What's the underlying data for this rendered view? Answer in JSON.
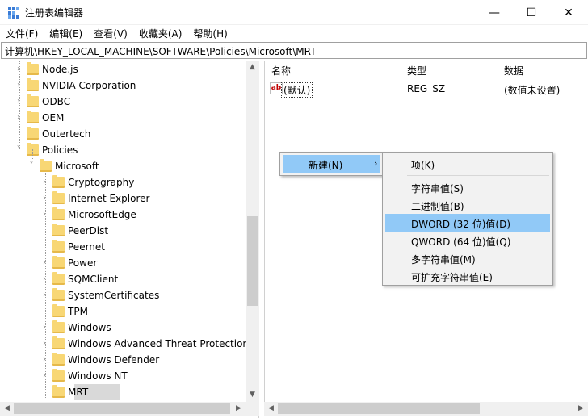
{
  "window": {
    "title": "注册表编辑器",
    "min_glyph": "—",
    "max_glyph": "☐",
    "close_glyph": "✕"
  },
  "menu": [
    "文件(F)",
    "编辑(E)",
    "查看(V)",
    "收藏夹(A)",
    "帮助(H)"
  ],
  "address": "计算机\\HKEY_LOCAL_MACHINE\\SOFTWARE\\Policies\\Microsoft\\MRT",
  "tree": [
    {
      "label": "Node.js",
      "level": 1,
      "expander": "›"
    },
    {
      "label": "NVIDIA Corporation",
      "level": 1,
      "expander": "›"
    },
    {
      "label": "ODBC",
      "level": 1,
      "expander": "›"
    },
    {
      "label": "OEM",
      "level": 1,
      "expander": "›"
    },
    {
      "label": "Outertech",
      "level": 1,
      "expander": ""
    },
    {
      "label": "Policies",
      "level": 1,
      "expander": "˅"
    },
    {
      "label": "Microsoft",
      "level": 2,
      "expander": "˅"
    },
    {
      "label": "Cryptography",
      "level": 3,
      "expander": "›"
    },
    {
      "label": "Internet Explorer",
      "level": 3,
      "expander": "›"
    },
    {
      "label": "MicrosoftEdge",
      "level": 3,
      "expander": "›"
    },
    {
      "label": "PeerDist",
      "level": 3,
      "expander": ""
    },
    {
      "label": "Peernet",
      "level": 3,
      "expander": ""
    },
    {
      "label": "Power",
      "level": 3,
      "expander": "›"
    },
    {
      "label": "SQMClient",
      "level": 3,
      "expander": "›"
    },
    {
      "label": "SystemCertificates",
      "level": 3,
      "expander": "›"
    },
    {
      "label": "TPM",
      "level": 3,
      "expander": ""
    },
    {
      "label": "Windows",
      "level": 3,
      "expander": "›"
    },
    {
      "label": "Windows Advanced Threat Protection",
      "level": 3,
      "expander": "›"
    },
    {
      "label": "Windows Defender",
      "level": 3,
      "expander": "›"
    },
    {
      "label": "Windows NT",
      "level": 3,
      "expander": "›"
    },
    {
      "label": "MRT",
      "level": 3,
      "expander": "",
      "selected": true
    }
  ],
  "list": {
    "headers": {
      "name": "名称",
      "type": "类型",
      "data": "数据"
    },
    "rows": [
      {
        "icon": "ab",
        "name": "(默认)",
        "type": "REG_SZ",
        "data": "(数值未设置)"
      }
    ]
  },
  "context_menu": {
    "new_label": "新建(N)",
    "new_arrow": "›",
    "submenu": [
      {
        "label": "项(K)"
      },
      {
        "separator": true
      },
      {
        "label": "字符串值(S)"
      },
      {
        "label": "二进制值(B)"
      },
      {
        "label": "DWORD (32 位)值(D)",
        "highlighted": true
      },
      {
        "label": "QWORD (64 位)值(Q)"
      },
      {
        "label": "多字符串值(M)"
      },
      {
        "label": "可扩充字符串值(E)"
      }
    ]
  },
  "colors": {
    "highlight": "#91c9f7",
    "folder": "#f8d775",
    "selected_tree_bg": "#d9d9d9",
    "menu_bg": "#f2f2f2"
  }
}
